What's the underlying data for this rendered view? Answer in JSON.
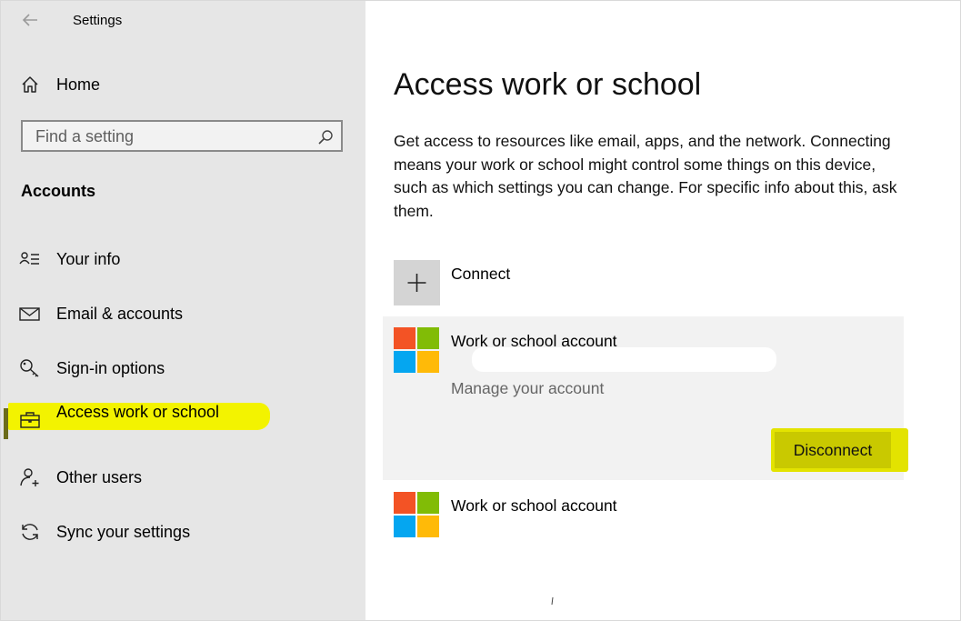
{
  "window": {
    "title": "Settings"
  },
  "sidebar": {
    "home_label": "Home",
    "search_placeholder": "Find a setting",
    "section_title": "Accounts",
    "items": [
      {
        "label": "Your info",
        "icon": "person-list-icon",
        "active": false
      },
      {
        "label": "Email & accounts",
        "icon": "mail-icon",
        "active": false
      },
      {
        "label": "Sign-in options",
        "icon": "key-icon",
        "active": false
      },
      {
        "label": "Access work or school",
        "icon": "briefcase-icon",
        "active": true
      },
      {
        "label": "Other users",
        "icon": "person-add-icon",
        "active": false
      },
      {
        "label": "Sync your settings",
        "icon": "sync-icon",
        "active": false
      }
    ]
  },
  "main": {
    "title": "Access work or school",
    "description": "Get access to resources like email, apps, and the network. Connecting means your work or school might control some things on this device, such as which settings you can change. For specific info about this, ask them.",
    "connect_label": "Connect",
    "accounts": [
      {
        "name": "Work or school account",
        "manage_label": "Manage your account",
        "disconnect_label": "Disconnect",
        "expanded": true
      },
      {
        "name": "Work or school account",
        "expanded": false
      }
    ]
  },
  "colors": {
    "sidebar_bg": "#e6e6e6",
    "highlight": "#f3f300",
    "ms_red": "#f35325",
    "ms_green": "#81bc06",
    "ms_blue": "#05a6f0",
    "ms_yellow": "#ffba08"
  }
}
